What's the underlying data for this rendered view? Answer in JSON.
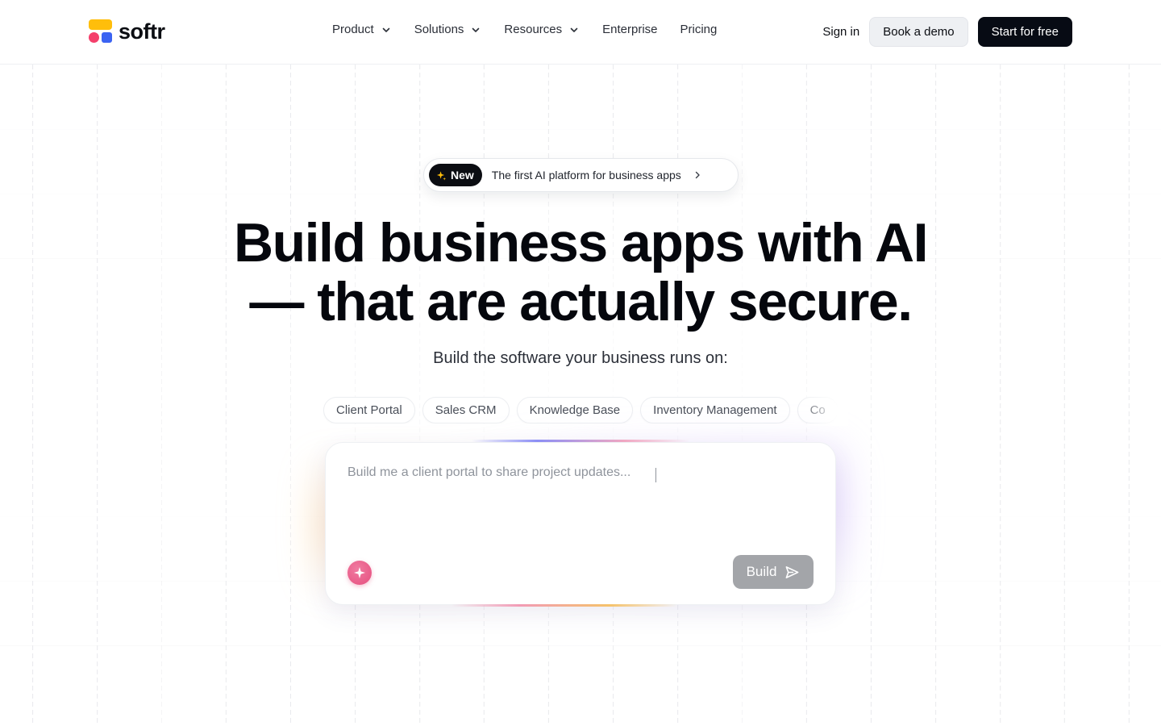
{
  "brand": {
    "name": "softr"
  },
  "nav": {
    "items": [
      {
        "label": "Product",
        "has_dropdown": true
      },
      {
        "label": "Solutions",
        "has_dropdown": true
      },
      {
        "label": "Resources",
        "has_dropdown": true
      },
      {
        "label": "Enterprise",
        "has_dropdown": false
      },
      {
        "label": "Pricing",
        "has_dropdown": false
      }
    ]
  },
  "header_actions": {
    "sign_in": "Sign in",
    "book_demo": "Book a demo",
    "start_free": "Start for free"
  },
  "announcement": {
    "tag": "New",
    "text": "The first AI platform for business apps"
  },
  "hero": {
    "headline_line1": "Build business apps with AI",
    "headline_line2": "— that are actually secure.",
    "subheadline": "Build the software your business runs on:"
  },
  "use_cases": [
    "Client Portal",
    "Sales CRM",
    "Knowledge Base",
    "Inventory Management",
    "Co"
  ],
  "prompt": {
    "placeholder": "Build me a client portal to share project updates...",
    "build_label": "Build"
  },
  "colors": {
    "brand_yellow": "#ffbe0b",
    "brand_pink": "#f43f6b",
    "brand_blue": "#3b63f2",
    "primary_dark": "#070b14",
    "build_button_disabled": "#a3a5a9"
  },
  "icons": {
    "dropdown": "chevron-down-icon",
    "badge": "sparkle-icon",
    "badge_arrow": "chevron-right-icon",
    "ai": "sparkle-icon",
    "send": "send-icon"
  }
}
